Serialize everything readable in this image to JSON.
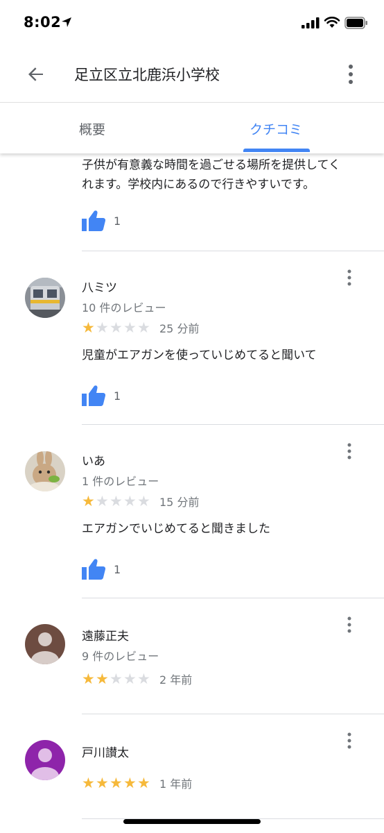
{
  "status_bar": {
    "time": "8:02"
  },
  "header": {
    "title": "足立区立北鹿浜小学校"
  },
  "tabs": [
    {
      "label": "概要",
      "selected": false
    },
    {
      "label": "クチコミ",
      "selected": true
    }
  ],
  "colors": {
    "accent": "#4285f4",
    "star": "#f6b93b"
  },
  "top_review": {
    "text_line1": "子供が有意義な時間を過ごせる場所を提供してく",
    "text_line2": "れます。学校内にあるので行きやすいです。",
    "likes": "1"
  },
  "reviews": [
    {
      "name": "八ミツ",
      "review_count": "10 件のレビュー",
      "rating": 1,
      "time": "25 分前",
      "text": "児童がエアガンを使っていじめてると聞いて",
      "likes": "1",
      "avatar": "train-photo"
    },
    {
      "name": "いあ",
      "review_count": "1 件のレビュー",
      "rating": 1,
      "time": "15 分前",
      "text": "エアガンでいじめてると聞きました",
      "likes": "1",
      "avatar": "rabbit-photo"
    },
    {
      "name": "遠藤正夫",
      "review_count": "9 件のレビュー",
      "rating": 2,
      "time": "2 年前",
      "avatar": "person-placeholder-brown"
    },
    {
      "name": "戸川讃太",
      "rating": 5,
      "time": "1 年前",
      "avatar": "person-placeholder-purple"
    }
  ]
}
